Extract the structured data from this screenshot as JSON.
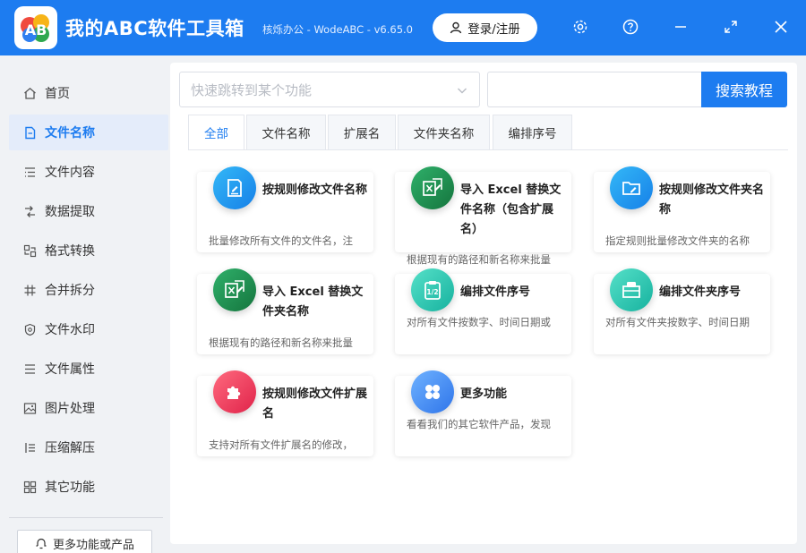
{
  "header": {
    "app_title": "我的ABC软件工具箱",
    "app_subtitle": "核烁办公 - WodeABC - v6.65.0",
    "login_label": "登录/注册",
    "logo_text": "AB"
  },
  "sidebar": {
    "items": [
      {
        "label": "首页",
        "icon": "home-icon"
      },
      {
        "label": "文件名称",
        "icon": "file-name-icon",
        "active": true
      },
      {
        "label": "文件内容",
        "icon": "list-icon"
      },
      {
        "label": "数据提取",
        "icon": "extract-icon"
      },
      {
        "label": "格式转换",
        "icon": "convert-icon"
      },
      {
        "label": "合并拆分",
        "icon": "merge-split-icon"
      },
      {
        "label": "文件水印",
        "icon": "watermark-icon"
      },
      {
        "label": "文件属性",
        "icon": "properties-icon"
      },
      {
        "label": "图片处理",
        "icon": "image-icon"
      },
      {
        "label": "压缩解压",
        "icon": "compress-icon"
      },
      {
        "label": "其它功能",
        "icon": "other-icon"
      }
    ],
    "more_label": "更多功能或产品"
  },
  "search": {
    "select_placeholder": "快速跳转到某个功能",
    "input_value": "",
    "button_label": "搜索教程"
  },
  "tabs": [
    {
      "label": "全部",
      "active": true
    },
    {
      "label": "文件名称"
    },
    {
      "label": "扩展名"
    },
    {
      "label": "文件夹名称"
    },
    {
      "label": "编排序号"
    }
  ],
  "cards": [
    {
      "title": "按规则修改文件名称",
      "desc": "批量修改所有文件的文件名，注",
      "icon": "edit-document-icon",
      "color": "#1e9af0"
    },
    {
      "title": "导入 Excel 替换文件名称（包含扩展名）",
      "desc": "根据现有的路径和新名称来批量",
      "icon": "excel-icon",
      "color": "#1f8f4e"
    },
    {
      "title": "按规则修改文件夹名称",
      "desc": "指定规则批量修改文件夹的名称",
      "icon": "folder-edit-icon",
      "color": "#1e9af0"
    },
    {
      "title": "导入 Excel 替换文件夹名称",
      "desc": "根据现有的路径和新名称来批量",
      "icon": "excel-icon",
      "color": "#1f8f4e"
    },
    {
      "title": "编排文件序号",
      "desc": "对所有文件按数字、时间日期或",
      "icon": "clipboard-number-icon",
      "color": "#2cc7b3"
    },
    {
      "title": "编排文件夹序号",
      "desc": "对所有文件夹按数字、时间日期",
      "icon": "folder-number-icon",
      "color": "#2cc7b3"
    },
    {
      "title": "按规则修改文件扩展名",
      "desc": "支持对所有文件扩展名的修改，",
      "icon": "puzzle-icon",
      "color": "#f0415e"
    },
    {
      "title": "更多功能",
      "desc": "看看我们的其它软件产品，发现",
      "icon": "more-apps-icon",
      "color": "#3f8df0"
    }
  ]
}
